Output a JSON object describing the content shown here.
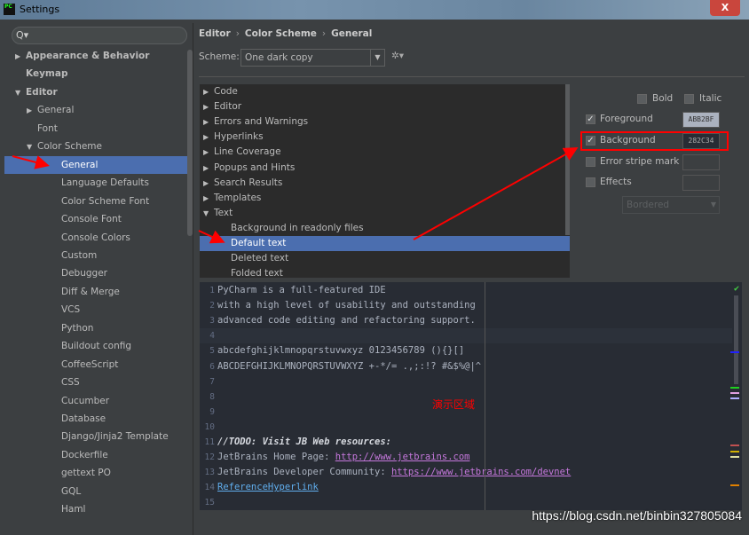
{
  "window": {
    "title": "Settings",
    "close": "X"
  },
  "search": {
    "placeholder": "Q▾"
  },
  "sidebar": {
    "items": [
      {
        "label": "Appearance & Behavior",
        "level": 0,
        "arrow": "▶",
        "bold": true
      },
      {
        "label": "Keymap",
        "level": 0,
        "arrow": "",
        "bold": true
      },
      {
        "label": "Editor",
        "level": 0,
        "arrow": "▼",
        "bold": true
      },
      {
        "label": "General",
        "level": 1,
        "arrow": "▶"
      },
      {
        "label": "Font",
        "level": 1,
        "arrow": ""
      },
      {
        "label": "Color Scheme",
        "level": 1,
        "arrow": "▼"
      },
      {
        "label": "General",
        "level": 2,
        "arrow": "",
        "selected": true
      },
      {
        "label": "Language Defaults",
        "level": 2
      },
      {
        "label": "Color Scheme Font",
        "level": 2
      },
      {
        "label": "Console Font",
        "level": 2
      },
      {
        "label": "Console Colors",
        "level": 2
      },
      {
        "label": "Custom",
        "level": 2
      },
      {
        "label": "Debugger",
        "level": 2
      },
      {
        "label": "Diff & Merge",
        "level": 2
      },
      {
        "label": "VCS",
        "level": 2
      },
      {
        "label": "Python",
        "level": 2
      },
      {
        "label": "Buildout config",
        "level": 2
      },
      {
        "label": "CoffeeScript",
        "level": 2
      },
      {
        "label": "CSS",
        "level": 2
      },
      {
        "label": "Cucumber",
        "level": 2
      },
      {
        "label": "Database",
        "level": 2
      },
      {
        "label": "Django/Jinja2 Template",
        "level": 2
      },
      {
        "label": "Dockerfile",
        "level": 2
      },
      {
        "label": "gettext PO",
        "level": 2
      },
      {
        "label": "GQL",
        "level": 2
      },
      {
        "label": "Haml",
        "level": 2
      }
    ]
  },
  "breadcrumb": [
    "Editor",
    "Color Scheme",
    "General"
  ],
  "breadcrumb_sep": "›",
  "scheme": {
    "label": "Scheme:",
    "value": "One dark copy",
    "dropdown": "▼",
    "gear": "✲▾"
  },
  "options": {
    "items": [
      {
        "label": "Code",
        "arrow": "▶"
      },
      {
        "label": "Editor",
        "arrow": "▶"
      },
      {
        "label": "Errors and Warnings",
        "arrow": "▶"
      },
      {
        "label": "Hyperlinks",
        "arrow": "▶"
      },
      {
        "label": "Line Coverage",
        "arrow": "▶"
      },
      {
        "label": "Popups and Hints",
        "arrow": "▶"
      },
      {
        "label": "Search Results",
        "arrow": "▶"
      },
      {
        "label": "Templates",
        "arrow": "▶"
      },
      {
        "label": "Text",
        "arrow": "▼"
      },
      {
        "label": "Background in readonly files",
        "child": true
      },
      {
        "label": "Default text",
        "child": true,
        "selected": true
      },
      {
        "label": "Deleted text",
        "child": true
      },
      {
        "label": "Folded text",
        "child": true
      }
    ]
  },
  "props": {
    "bold": "Bold",
    "italic": "Italic",
    "foreground": "Foreground",
    "foreground_value": "ABB2BF",
    "foreground_color": "#abb2bf",
    "background": "Background",
    "background_value": "282C34",
    "background_color": "#282c34",
    "error_stripe": "Error stripe mark",
    "effects": "Effects",
    "effects_type": "Bordered",
    "check": "✓"
  },
  "editor": {
    "lines": [
      {
        "n": "1",
        "t": "PyCharm is a full-featured IDE"
      },
      {
        "n": "2",
        "t": "with a high level of usability and outstanding"
      },
      {
        "n": "3",
        "t": "advanced code editing and refactoring support."
      },
      {
        "n": "4",
        "t": ""
      },
      {
        "n": "5",
        "t": "abcdefghijklmnopqrstuvwxyz 0123456789 (){}[]"
      },
      {
        "n": "6",
        "t": "ABCDEFGHIJKLMNOPQRSTUVWXYZ +-*/= .,;:!? #&$%@|^"
      },
      {
        "n": "7",
        "t": ""
      },
      {
        "n": "8",
        "t": ""
      },
      {
        "n": "9",
        "t": ""
      },
      {
        "n": "10",
        "t": ""
      },
      {
        "n": "11",
        "todo": "//TODO: Visit JB Web resources:"
      },
      {
        "n": "12",
        "t": "JetBrains Home Page: ",
        "link": "http://www.jetbrains.com"
      },
      {
        "n": "13",
        "t": "JetBrains Developer Community: ",
        "link": "https://www.jetbrains.com/devnet"
      },
      {
        "n": "14",
        "ref": "ReferenceHyperlink"
      },
      {
        "n": "15",
        "t": ""
      }
    ],
    "markers": [
      "#2020ff",
      "#20d020",
      "#e0a0e0",
      "#b0b0ff",
      "#c05050",
      "#d0b000",
      "#e0e0a0",
      "#e08000"
    ]
  },
  "annotation": "演示区域",
  "watermark": "https://blog.csdn.net/binbin327805084"
}
